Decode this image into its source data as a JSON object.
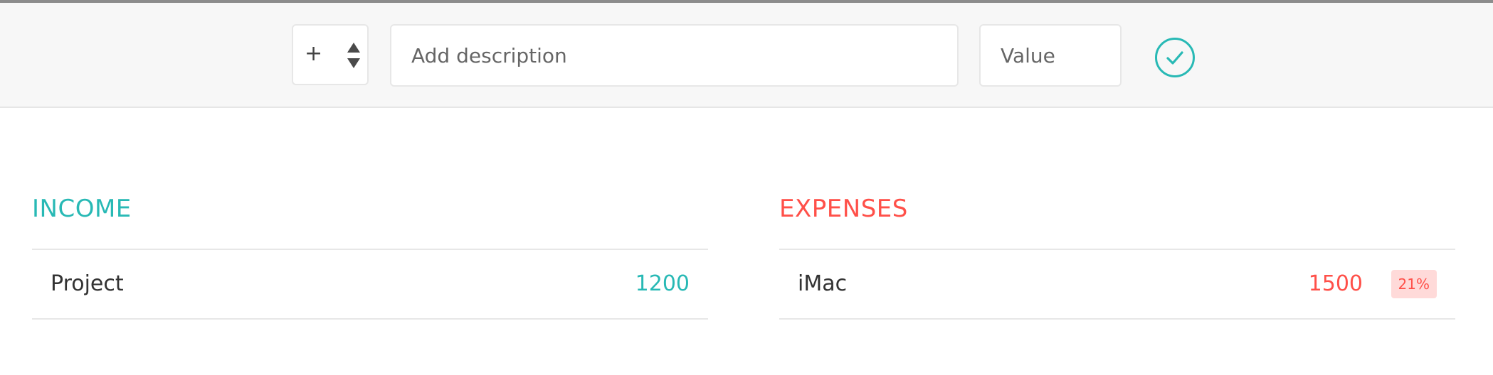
{
  "input_bar": {
    "type_select": {
      "selected": "+",
      "icon": "sort-arrows-icon"
    },
    "description": {
      "placeholder": "Add description",
      "value": ""
    },
    "value": {
      "placeholder": "Value",
      "value": ""
    },
    "add_button": {
      "icon": "checkmark-circle-icon"
    }
  },
  "income": {
    "title": "INCOME",
    "color": "#28b9b5",
    "items": [
      {
        "description": "Project",
        "value": "1200"
      }
    ]
  },
  "expenses": {
    "title": "EXPENSES",
    "color": "#ff5049",
    "items": [
      {
        "description": "iMac",
        "value": "1500",
        "percentage": "21%"
      }
    ]
  }
}
